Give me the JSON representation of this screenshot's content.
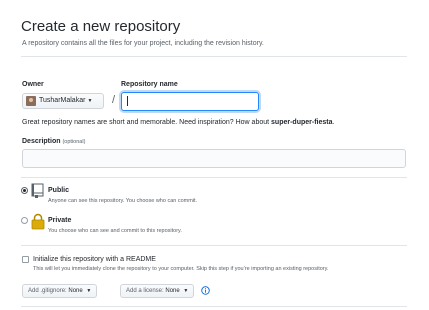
{
  "header": {
    "title": "Create a new repository",
    "subtitle": "A repository contains all the files for your project, including the revision history."
  },
  "owner": {
    "label": "Owner",
    "value": "TusharMalakar"
  },
  "repo_name": {
    "label": "Repository name",
    "separator": "/",
    "value": ""
  },
  "hint": {
    "text": "Great repository names are short and memorable. Need inspiration? How about",
    "suggestion": "super-duper-fiesta",
    "end": "."
  },
  "description": {
    "label": "Description",
    "optional": "(optional)",
    "value": ""
  },
  "visibility": {
    "selected": "public",
    "public": {
      "label": "Public",
      "desc": "Anyone can see this repository. You choose who can commit.",
      "icon": "repo-icon"
    },
    "private": {
      "label": "Private",
      "desc": "You choose who can see and commit to this repository.",
      "icon": "lock-icon"
    }
  },
  "readme": {
    "label": "Initialize this repository with a README",
    "desc": "This will let you immediately clone the repository to your computer. Skip this step if you’re importing an existing repository.",
    "checked": false
  },
  "gitignore": {
    "prefix": "Add .gitignore:",
    "value": "None"
  },
  "license": {
    "prefix": "Add a license:",
    "value": "None"
  },
  "colors": {
    "focus": "#2188ff",
    "lock": "#dbab09",
    "info": "#0366d6"
  }
}
